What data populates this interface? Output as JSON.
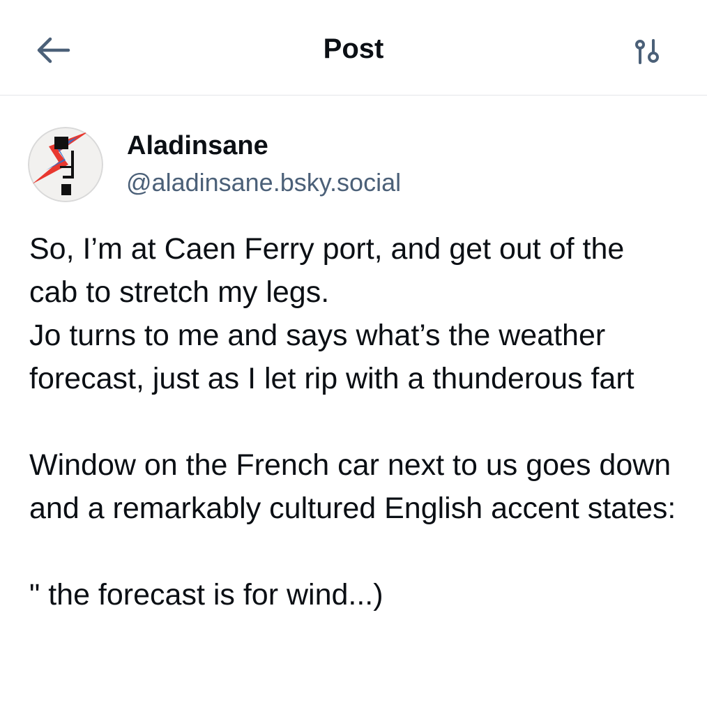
{
  "header": {
    "title": "Post"
  },
  "icons": {
    "back": "arrow-left-icon",
    "filter": "sliders-icon"
  },
  "colors": {
    "text": "#0b0f14",
    "handle": "#4b6078",
    "icon": "#4b6078",
    "divider": "#e3e6ea"
  },
  "post": {
    "author": {
      "display_name": "Aladinsane",
      "handle": "@aladinsane.bsky.social"
    },
    "paragraphs": [
      "So, I’m at Caen Ferry port, and get out of the cab to stretch my legs.",
      "Jo turns to me and says what’s the weather forecast, just as I let rip with a thunderous fart",
      "Window on the French car next to us goes down and a remarkably cultured English accent states:",
      "\" the forecast is for wind...)"
    ]
  }
}
